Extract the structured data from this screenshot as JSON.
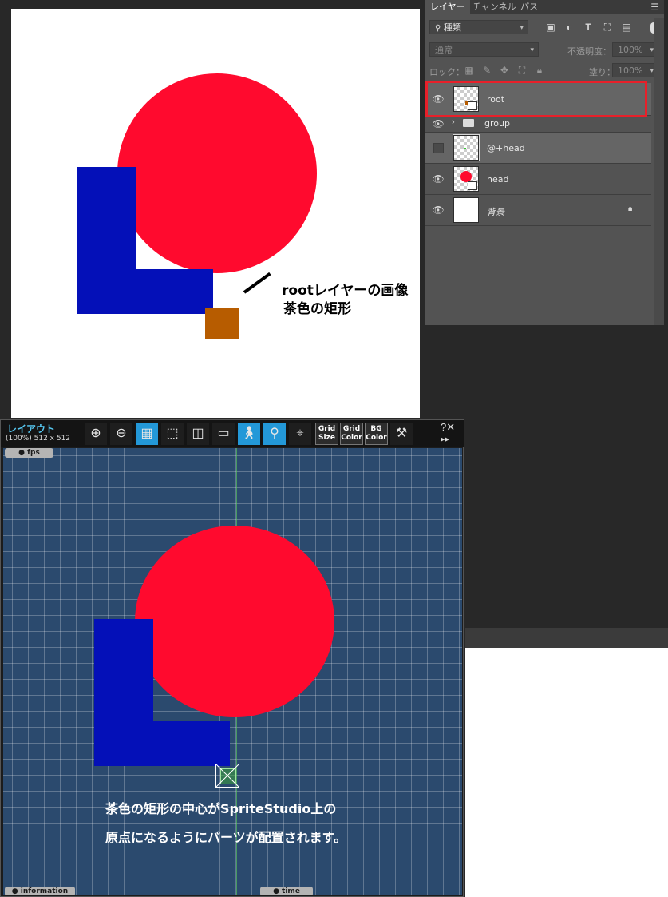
{
  "layers_panel": {
    "tabs": [
      "レイヤー",
      "チャンネル",
      "パス"
    ],
    "filter_kind": "種類",
    "blend_mode": "通常",
    "opacity_label": "不透明度：",
    "opacity_value": "100%",
    "lock_label": "ロック：",
    "fill_label": "塗り：",
    "fill_value": "100%",
    "layers": [
      {
        "name": "root",
        "visible": true,
        "selected_highlight": true
      },
      {
        "name": "group",
        "visible": true,
        "type": "folder"
      },
      {
        "name": "@+head",
        "visible": false
      },
      {
        "name": "head",
        "visible": true
      },
      {
        "name": "背景",
        "visible": true,
        "locked": true
      }
    ]
  },
  "ps_canvas": {
    "annotation_line1": "rootレイヤーの画像",
    "annotation_line2": "茶色の矩形",
    "colors": {
      "circle": "#ff0a2e",
      "l_shape": "#0410b8",
      "square": "#b75c00"
    }
  },
  "layout_window": {
    "title": "レイアウト",
    "size_info": "(100%) 512 x 512",
    "toolbar": {
      "grid_size": [
        "Grid",
        "Size"
      ],
      "grid_color": [
        "Grid",
        "Color"
      ],
      "bg_color": [
        "BG",
        "Color"
      ]
    },
    "help_close": "?✕",
    "play_icon": "▸▸",
    "fps_label": "● fps",
    "information_label": "● information",
    "time_label": "● time",
    "caption_line1": "茶色の矩形の中心がSpriteStudio上の",
    "caption_line2": "原点になるようにパーツが配置されます。"
  }
}
